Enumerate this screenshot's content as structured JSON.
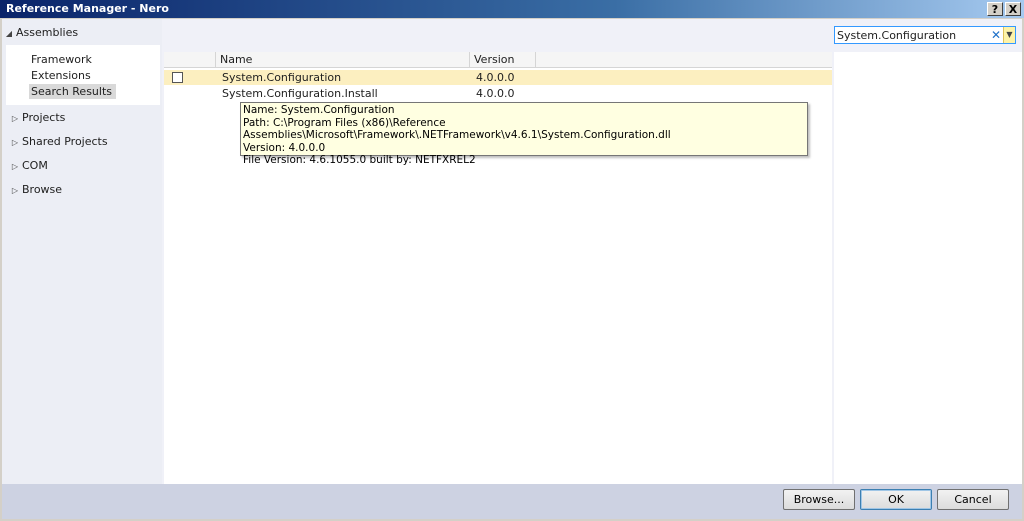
{
  "window": {
    "title": "Reference Manager - Nero",
    "help_label": "?",
    "close_label": "X"
  },
  "nav": {
    "assemblies_label": "Assemblies",
    "sub_items": [
      {
        "label": "Framework"
      },
      {
        "label": "Extensions"
      },
      {
        "label": "Search Results",
        "selected": true
      }
    ],
    "items": [
      {
        "label": "Projects"
      },
      {
        "label": "Shared Projects"
      },
      {
        "label": "COM"
      },
      {
        "label": "Browse"
      }
    ]
  },
  "list": {
    "columns": {
      "name": "Name",
      "version": "Version"
    },
    "rows": [
      {
        "name": "System.Configuration",
        "version": "4.0.0.0",
        "highlighted": true,
        "checked": false
      },
      {
        "name": "System.Configuration.Install",
        "version": "4.0.0.0",
        "highlighted": false
      }
    ]
  },
  "tooltip": {
    "lines": [
      "Name: System.Configuration",
      "Path: C:\\Program Files (x86)\\Reference Assemblies\\Microsoft\\Framework\\.NETFramework\\v4.6.1\\System.Configuration.dll",
      "Version: 4.0.0.0",
      "File Version: 4.6.1055.0 built by: NETFXREL2"
    ]
  },
  "search": {
    "value": "System.Configuration",
    "clear_icon": "close-icon",
    "dropdown_icon": "chevron-down-icon"
  },
  "footer": {
    "browse_label": "Browse...",
    "ok_label": "OK",
    "cancel_label": "Cancel"
  },
  "colors": {
    "highlight_row": "#fcefc0",
    "tooltip_bg": "#ffffe1",
    "accent": "#3399ff"
  }
}
